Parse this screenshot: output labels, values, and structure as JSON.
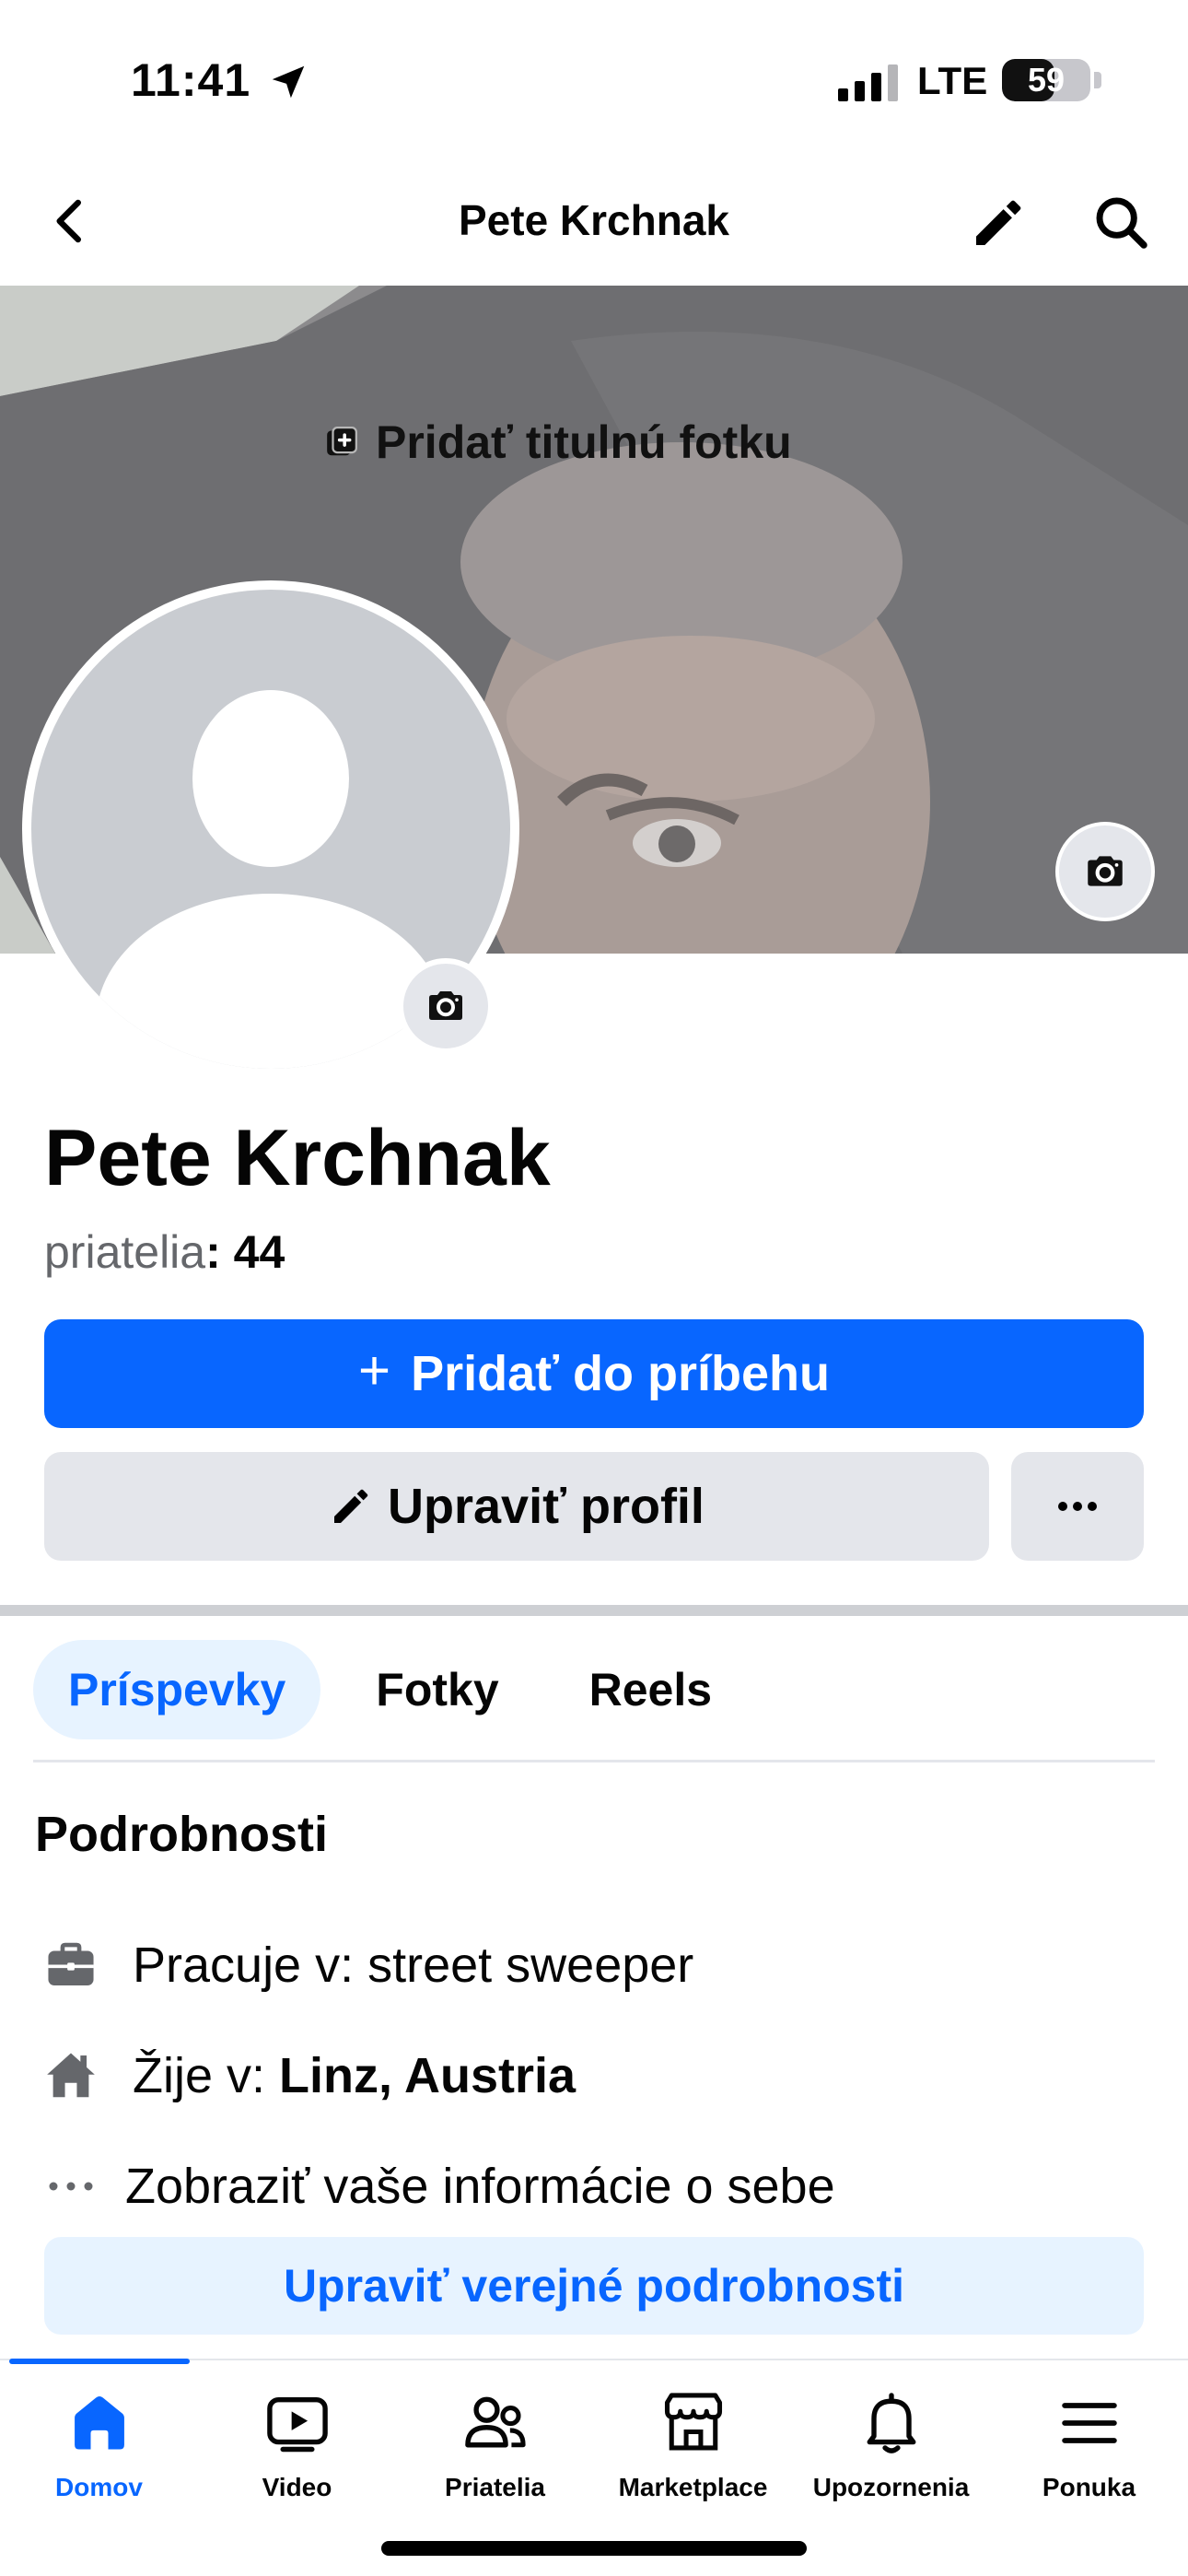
{
  "status_bar": {
    "time": "11:41",
    "network": "LTE",
    "battery": "59",
    "battery_level": 0.59
  },
  "header": {
    "title": "Pete Krchnak",
    "icons": [
      "back-icon",
      "pencil-icon",
      "search-icon"
    ]
  },
  "cover": {
    "add_cover_label": "Pridať titulnú fotku"
  },
  "profile": {
    "name": "Pete Krchnak",
    "friends_label": "priatelia",
    "friends_sep": ": ",
    "friends_count": "44"
  },
  "actions": {
    "add_story_plus": "+",
    "add_story_label": "Pridať do príbehu",
    "edit_profile_label": "Upraviť profil"
  },
  "tabs": [
    {
      "label": "Príspevky",
      "active": true
    },
    {
      "label": "Fotky",
      "active": false
    },
    {
      "label": "Reels",
      "active": false
    }
  ],
  "details": {
    "title": "Podrobnosti",
    "work_prefix": "Pracuje v: ",
    "work_value": "street sweeper",
    "lives_prefix": "Žije v: ",
    "lives_value": "Linz, Austria",
    "about_label": "Zobraziť vaše informácie o sebe",
    "edit_public_label": "Upraviť verejné podrobnosti"
  },
  "bottom_nav": [
    {
      "label": "Domov",
      "icon": "home-icon",
      "active": true
    },
    {
      "label": "Video",
      "icon": "video-icon",
      "active": false
    },
    {
      "label": "Priatelia",
      "icon": "friends-icon",
      "active": false
    },
    {
      "label": "Marketplace",
      "icon": "marketplace-icon",
      "active": false
    },
    {
      "label": "Upozornenia",
      "icon": "bell-icon",
      "active": false
    },
    {
      "label": "Ponuka",
      "icon": "menu-icon",
      "active": false
    }
  ],
  "colors": {
    "accent": "#0866ff",
    "accent_light": "#e7f3ff",
    "button_gray": "#e4e6eb",
    "secondary_text": "#65676b"
  }
}
